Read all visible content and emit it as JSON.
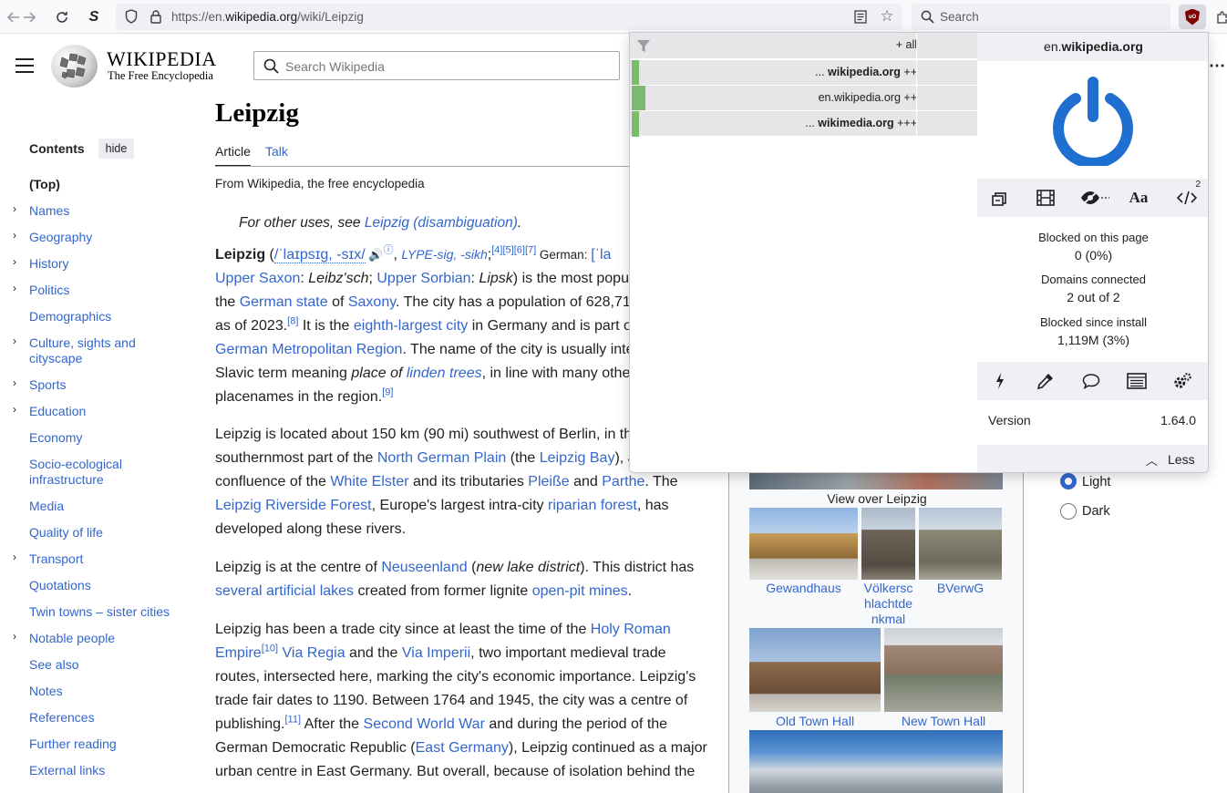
{
  "browser": {
    "url_prefix": "https://en.",
    "url_domain": "wikipedia.org",
    "url_path": "/wiki/Leipzig",
    "search_placeholder": "Search",
    "ext_badge": "uO"
  },
  "wiki": {
    "wordmark": "WIKIPEDIA",
    "tagline": "The Free Encyclopedia",
    "search_placeholder": "Search Wikipedia"
  },
  "toc": {
    "heading": "Contents",
    "hide_label": "hide",
    "items": [
      {
        "label": "(Top)"
      },
      {
        "label": "Names"
      },
      {
        "label": "Geography"
      },
      {
        "label": "History"
      },
      {
        "label": "Politics"
      },
      {
        "label": "Demographics"
      },
      {
        "label": "Culture, sights and cityscape"
      },
      {
        "label": "Sports"
      },
      {
        "label": "Education"
      },
      {
        "label": "Economy"
      },
      {
        "label": "Socio-ecological infrastructure"
      },
      {
        "label": "Media"
      },
      {
        "label": "Quality of life"
      },
      {
        "label": "Transport"
      },
      {
        "label": "Quotations"
      },
      {
        "label": "Twin towns – sister cities"
      },
      {
        "label": "Notable people"
      },
      {
        "label": "See also"
      },
      {
        "label": "Notes"
      },
      {
        "label": "References"
      },
      {
        "label": "Further reading"
      },
      {
        "label": "External links"
      }
    ]
  },
  "article": {
    "title": "Leipzig",
    "tab_article": "Article",
    "tab_talk": "Talk",
    "from": "From Wikipedia, the free encyclopedia",
    "hatnote_prefix": "For other uses, see ",
    "hatnote_link": "Leipzig (disambiguation)",
    "hatnote_suffix": ".",
    "p1": {
      "l1_bold": "Leipzig",
      "l1_a": " (",
      "l1_ipa": "/ˈlaɪpsɪɡ, -sɪx/",
      "l1_b": ", ",
      "l1_resp": "LYPE-sig, -sikh",
      "l1_c": ";",
      "l1_refs": "[4][5][6][7]",
      "l1_d": " German: ",
      "l1_e": "[ˈla",
      "l2_a": "Upper Saxon",
      "l2_b": ": ",
      "l2_c": "Leibz'sch",
      "l2_d": "; ",
      "l2_e": "Upper Sorbian",
      "l2_f": ": ",
      "l2_g": "Lipsk",
      "l2_h": ") is the most popu",
      "l3_a": "the ",
      "l3_b": "German state",
      "l3_c": " of ",
      "l3_d": "Saxony",
      "l3_e": ". The city has a population of 628,71",
      "l4_a": "as of 2023.",
      "l4_ref": "[8]",
      "l4_b": " It is the ",
      "l4_c": "eighth-largest city",
      "l4_d": " in Germany and is part o",
      "l5_a": "German Metropolitan Region",
      "l5_b": ". The name of the city is usually inte",
      "l6_a": "Slavic term meaning ",
      "l6_b": "place of ",
      "l6_c": "linden trees",
      "l6_d": ", in line with many othe",
      "l7_a": "placenames in the region.",
      "l7_ref": "[9]"
    },
    "p2": {
      "l1": "Leipzig is located about 150 km (90 mi) southwest of Berlin, in th",
      "l2_a": "southernmost part of the ",
      "l2_b": "North German Plain",
      "l2_c": " (the ",
      "l2_d": "Leipzig Bay",
      "l2_e": "), a",
      "l3_a": "confluence of the ",
      "l3_b": "White Elster",
      "l3_c": " and its tributaries ",
      "l3_d": "Pleiße",
      "l3_e": " and ",
      "l3_f": "Parthe",
      "l3_g": ". The",
      "l4_a": "Leipzig Riverside Forest",
      "l4_b": ", Europe's largest intra-city ",
      "l4_c": "riparian forest",
      "l4_d": ", has",
      "l5": "developed along these rivers."
    },
    "p3": {
      "l1_a": "Leipzig is at the centre of ",
      "l1_b": "Neuseenland",
      "l1_c": " (",
      "l1_d": "new lake district",
      "l1_e": "). This district has",
      "l2_a": "several artificial lakes",
      "l2_b": " created from former lignite ",
      "l2_c": "open-pit mines",
      "l2_d": "."
    },
    "p4": {
      "l1_a": "Leipzig has been a trade city since at least the time of the ",
      "l1_b": "Holy Roman",
      "l2_a": "Empire",
      "l2_ref": "[10]",
      "l2_b": " ",
      "l2_c": "Via Regia",
      "l2_d": " and the ",
      "l2_e": "Via Imperii",
      "l2_f": ", two important medieval trade",
      "l3": "routes, intersected here, marking the city's economic importance. Leipzig's",
      "l4": "trade fair dates to 1190. Between 1764 and 1945, the city was a centre of",
      "l5_a": "publishing.",
      "l5_ref": "[11]",
      "l5_b": " After the ",
      "l5_c": "Second World War",
      "l5_d": " and during the period of the",
      "l6_a": "German Democratic Republic (",
      "l6_b": "East Germany",
      "l6_c": "), Leipzig continued as a major",
      "l7": "urban centre in East Germany. But overall, because of isolation behind the"
    }
  },
  "gallery": {
    "view_caption": "View over Leipzig",
    "captions": [
      "Gewandhaus",
      "Völkersc\nhlachtde\nnkmal",
      "BVerwG",
      "Old Town Hall",
      "New Town Hall"
    ]
  },
  "appearance": {
    "light": "Light",
    "dark": "Dark",
    "selected": "Light"
  },
  "ubo": {
    "all_label": "+ all",
    "rows": [
      {
        "prefix": "... ",
        "domain": "wikipedia.org",
        "suffix": " ++",
        "bold": true,
        "bar_fraction": 0.02
      },
      {
        "prefix": "",
        "domain": "en.wikipedia.org",
        "suffix": " ++",
        "bold": false,
        "bar_fraction": 0.04
      },
      {
        "prefix": "... ",
        "domain": "wikimedia.org",
        "suffix": " +++",
        "bold": true,
        "bar_fraction": 0.02
      }
    ],
    "hostname_prefix": "en.",
    "hostname_domain": "wikipedia.org",
    "tools": [
      "element-zapper-icon",
      "media-icon",
      "cosmetic-filter-icon",
      "fonts-icon",
      "scripts-icon"
    ],
    "scripts_count": "2",
    "fonts_label": "Aa",
    "blocked_page_label": "Blocked on this page",
    "blocked_page_value": "0 (0%)",
    "domains_label": "Domains connected",
    "domains_value": "2 out of 2",
    "blocked_install_label": "Blocked since install",
    "blocked_install_value": "1,119M (3%)",
    "tools2": [
      "zap-icon",
      "picker-icon",
      "report-icon",
      "logger-icon",
      "dashboard-icon"
    ],
    "version_label": "Version",
    "version_value": "1.64.0",
    "less_label": "Less",
    "power_color": "#1f6fd0"
  }
}
